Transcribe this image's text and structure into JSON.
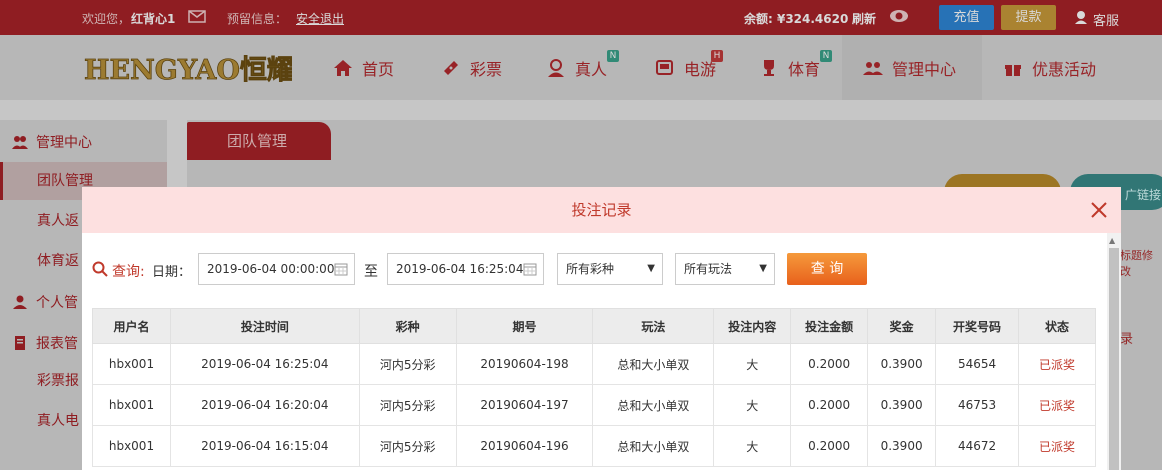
{
  "topbar": {
    "welcome": "欢迎您，",
    "username": "红背心1",
    "notice_label": "预留信息：",
    "logout": "安全退出",
    "balance": "余额: ¥324.4620",
    "refresh": "刷新",
    "deposit": "充值",
    "withdraw": "提款",
    "service": "客服"
  },
  "nav": {
    "logo_text": "HENGYAO恒耀",
    "items": [
      {
        "label": "首页",
        "icon": "home-icon"
      },
      {
        "label": "彩票",
        "icon": "ticket-icon"
      },
      {
        "label": "真人",
        "icon": "dealer-icon",
        "badge": "N"
      },
      {
        "label": "电游",
        "icon": "arcade-icon",
        "badge": "H"
      },
      {
        "label": "体育",
        "icon": "trophy-icon",
        "badge": "N"
      },
      {
        "label": "管理中心",
        "icon": "users-icon"
      },
      {
        "label": "优惠活动",
        "icon": "gift-icon"
      }
    ]
  },
  "sidebar": {
    "sections": [
      {
        "title": "管理中心",
        "icon": "users-icon"
      },
      {
        "title": "个人管",
        "icon": "user-icon"
      },
      {
        "title": "报表管",
        "icon": "report-icon"
      }
    ],
    "items": [
      "团队管理",
      "真人返",
      "体育返",
      "彩票报",
      "真人电"
    ]
  },
  "main": {
    "tab": "团队管理",
    "teal_pill": "广链接",
    "bg_text1": "标题修改",
    "bg_text2": "录"
  },
  "modal": {
    "title": "投注记录",
    "query_label": "查询:",
    "date_label": "日期：",
    "start_date": "2019-06-04 00:00:00",
    "to_label": "至",
    "end_date": "2019-06-04 16:25:04",
    "lottery_select": "所有彩种",
    "play_select": "所有玩法",
    "query_button": "查 询",
    "columns": [
      "用户名",
      "投注时间",
      "彩种",
      "期号",
      "玩法",
      "投注内容",
      "投注金额",
      "奖金",
      "开奖号码",
      "状态"
    ],
    "rows": [
      [
        "hbx001",
        "2019-06-04 16:25:04",
        "河内5分彩",
        "20190604-198",
        "总和大小单双",
        "大",
        "0.2000",
        "0.3900",
        "54654",
        "已派奖"
      ],
      [
        "hbx001",
        "2019-06-04 16:20:04",
        "河内5分彩",
        "20190604-197",
        "总和大小单双",
        "大",
        "0.2000",
        "0.3900",
        "46753",
        "已派奖"
      ],
      [
        "hbx001",
        "2019-06-04 16:15:04",
        "河内5分彩",
        "20190604-196",
        "总和大小单双",
        "大",
        "0.2000",
        "0.3900",
        "44672",
        "已派奖"
      ]
    ]
  },
  "colors": {
    "brand_red": "#a82328",
    "accent_orange": "#e8601c",
    "status_red": "#c0392b"
  }
}
